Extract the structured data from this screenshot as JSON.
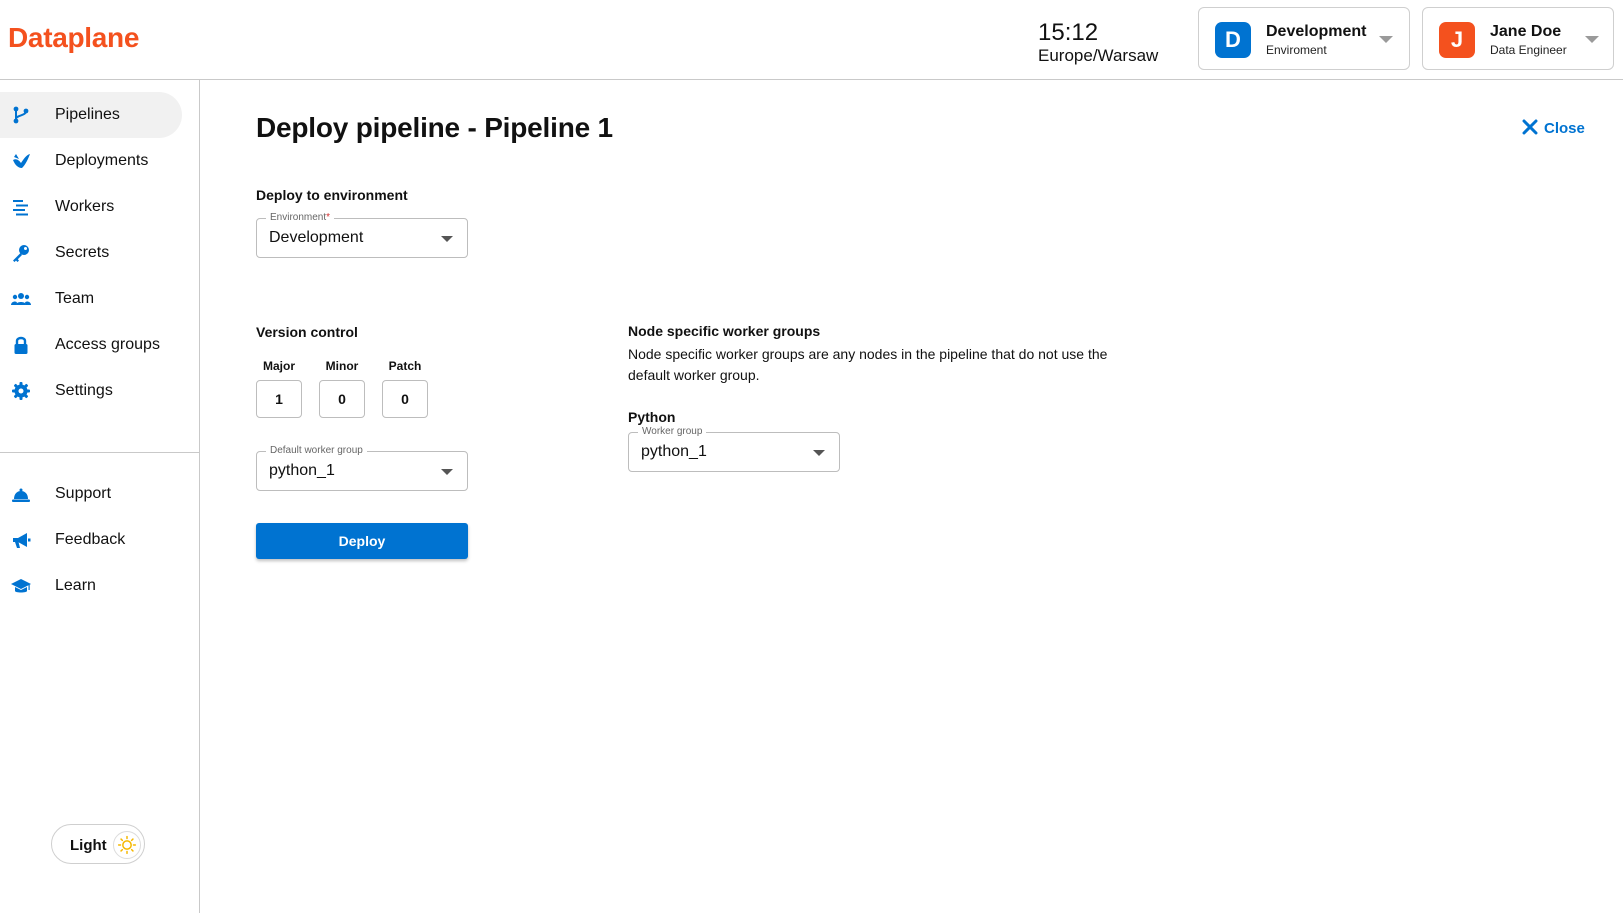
{
  "header": {
    "logo": "Dataplane",
    "time": "15:12",
    "timezone": "Europe/Warsaw",
    "environment": {
      "badge": "D",
      "title": "Development",
      "subtitle": "Enviroment"
    },
    "user": {
      "badge": "J",
      "name": "Jane Doe",
      "role": "Data Engineer"
    }
  },
  "sidebar": {
    "items": [
      {
        "label": "Pipelines",
        "icon": "pipelines-icon",
        "active": true
      },
      {
        "label": "Deployments",
        "icon": "deployments-icon"
      },
      {
        "label": "Workers",
        "icon": "workers-icon"
      },
      {
        "label": "Secrets",
        "icon": "key-icon"
      },
      {
        "label": "Team",
        "icon": "team-icon"
      },
      {
        "label": "Access groups",
        "icon": "lock-icon"
      },
      {
        "label": "Settings",
        "icon": "gear-icon"
      }
    ],
    "secondary": [
      {
        "label": "Support",
        "icon": "bell-icon"
      },
      {
        "label": "Feedback",
        "icon": "megaphone-icon"
      },
      {
        "label": "Learn",
        "icon": "graduation-cap-icon"
      }
    ],
    "theme_label": "Light"
  },
  "main": {
    "title": "Deploy pipeline - Pipeline 1",
    "close_label": "Close",
    "deploy_env": {
      "heading": "Deploy to environment",
      "field_label": "Environment",
      "required_mark": "*",
      "value": "Development"
    },
    "version": {
      "heading": "Version control",
      "major_label": "Major",
      "major": "1",
      "minor_label": "Minor",
      "minor": "0",
      "patch_label": "Patch",
      "patch": "0"
    },
    "default_worker": {
      "label": "Default worker group",
      "value": "python_1"
    },
    "deploy_label": "Deploy",
    "node_groups": {
      "heading": "Node specific worker groups",
      "description": "Node specific worker groups are any nodes in the pipeline that do not use the default worker group.",
      "python_label": "Python",
      "field_label": "Worker group",
      "value": "python_1"
    }
  },
  "colors": {
    "brand": "#f4511e",
    "accent": "#0073d1"
  }
}
